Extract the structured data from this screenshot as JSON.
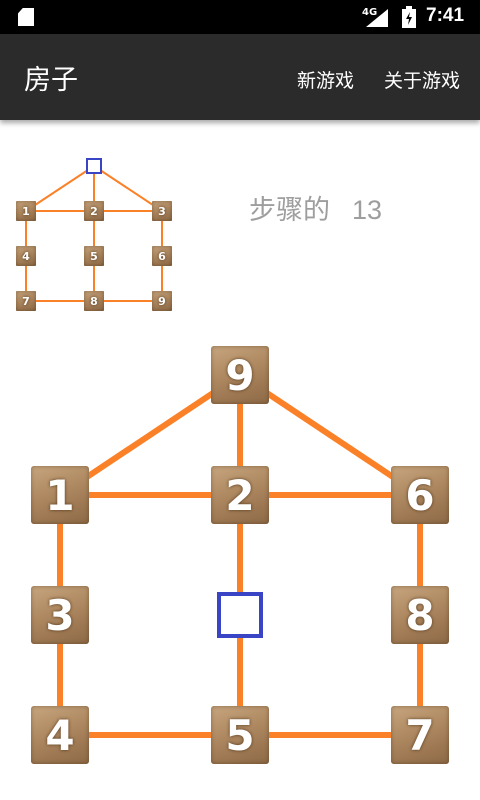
{
  "status_bar": {
    "network": "4G",
    "time": "7:41"
  },
  "app_bar": {
    "title": "房子",
    "new_game": "新游戏",
    "about": "关于游戏"
  },
  "steps": {
    "label": "步骤的",
    "value": "13"
  },
  "colors": {
    "edge": "#fa8128",
    "empty_border": "#3a45c6",
    "wood": "#a9845d"
  },
  "goal_board": {
    "cells": [
      {
        "pos": "top",
        "label": ""
      },
      {
        "pos": "l1",
        "label": "1"
      },
      {
        "pos": "c1",
        "label": "2"
      },
      {
        "pos": "r1",
        "label": "3"
      },
      {
        "pos": "l2",
        "label": "4"
      },
      {
        "pos": "c2",
        "label": "5"
      },
      {
        "pos": "r2",
        "label": "6"
      },
      {
        "pos": "l3",
        "label": "7"
      },
      {
        "pos": "c3",
        "label": "8"
      },
      {
        "pos": "r3",
        "label": "9"
      }
    ]
  },
  "game_board": {
    "cells": [
      {
        "pos": "top",
        "label": "9"
      },
      {
        "pos": "l1",
        "label": "1"
      },
      {
        "pos": "c1",
        "label": "2"
      },
      {
        "pos": "r1",
        "label": "6"
      },
      {
        "pos": "l2",
        "label": "3"
      },
      {
        "pos": "c2",
        "label": ""
      },
      {
        "pos": "r2",
        "label": "8"
      },
      {
        "pos": "l3",
        "label": "4"
      },
      {
        "pos": "c3",
        "label": "5"
      },
      {
        "pos": "r3",
        "label": "7"
      }
    ]
  }
}
